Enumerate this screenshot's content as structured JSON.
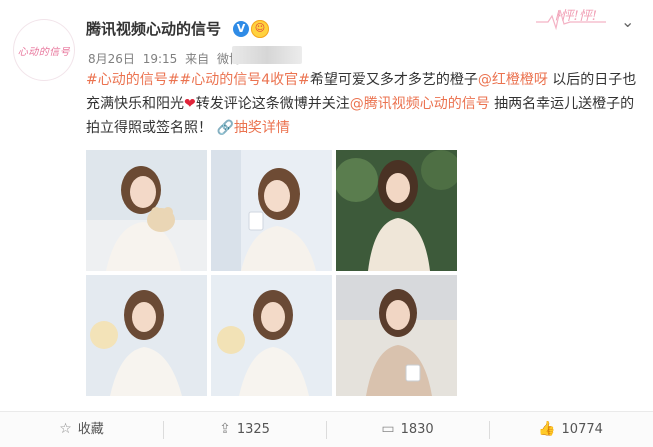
{
  "header": {
    "avatar_text": "心动的信号",
    "username": "腾讯视频心动的信号",
    "verified_icon": "v-verified-icon",
    "emoji_badge": "smiley-badge-icon",
    "date": "8月26日",
    "time": "19:15",
    "source_prefix": "来自",
    "source_partial": "微博",
    "deco_text": "ﾄ怦!怦!",
    "more_icon": "chevron-down-icon"
  },
  "post": {
    "tag1": "#心动的信号#",
    "tag2": "#心动的信号4收官#",
    "text1": "希望可爱又多才多艺的橙子",
    "mention1": "@红橙橙呀",
    "text2": " 以后的日子也充满快乐和阳光",
    "heart": "❤",
    "text3": "转发评论这条微博并关注",
    "mention2": "@腾讯视频心动的信号",
    "text4": " 抽两名幸运儿送橙子的拍立得照或签名照！",
    "lottery_label": "抽奖详情"
  },
  "actions": {
    "favorite_label": "收藏",
    "repost_count": "1325",
    "comment_count": "1830",
    "like_count": "10774"
  },
  "colors": {
    "link": "#eb7350",
    "verified": "#2f8be6",
    "text": "#333333",
    "meta": "#808080"
  }
}
